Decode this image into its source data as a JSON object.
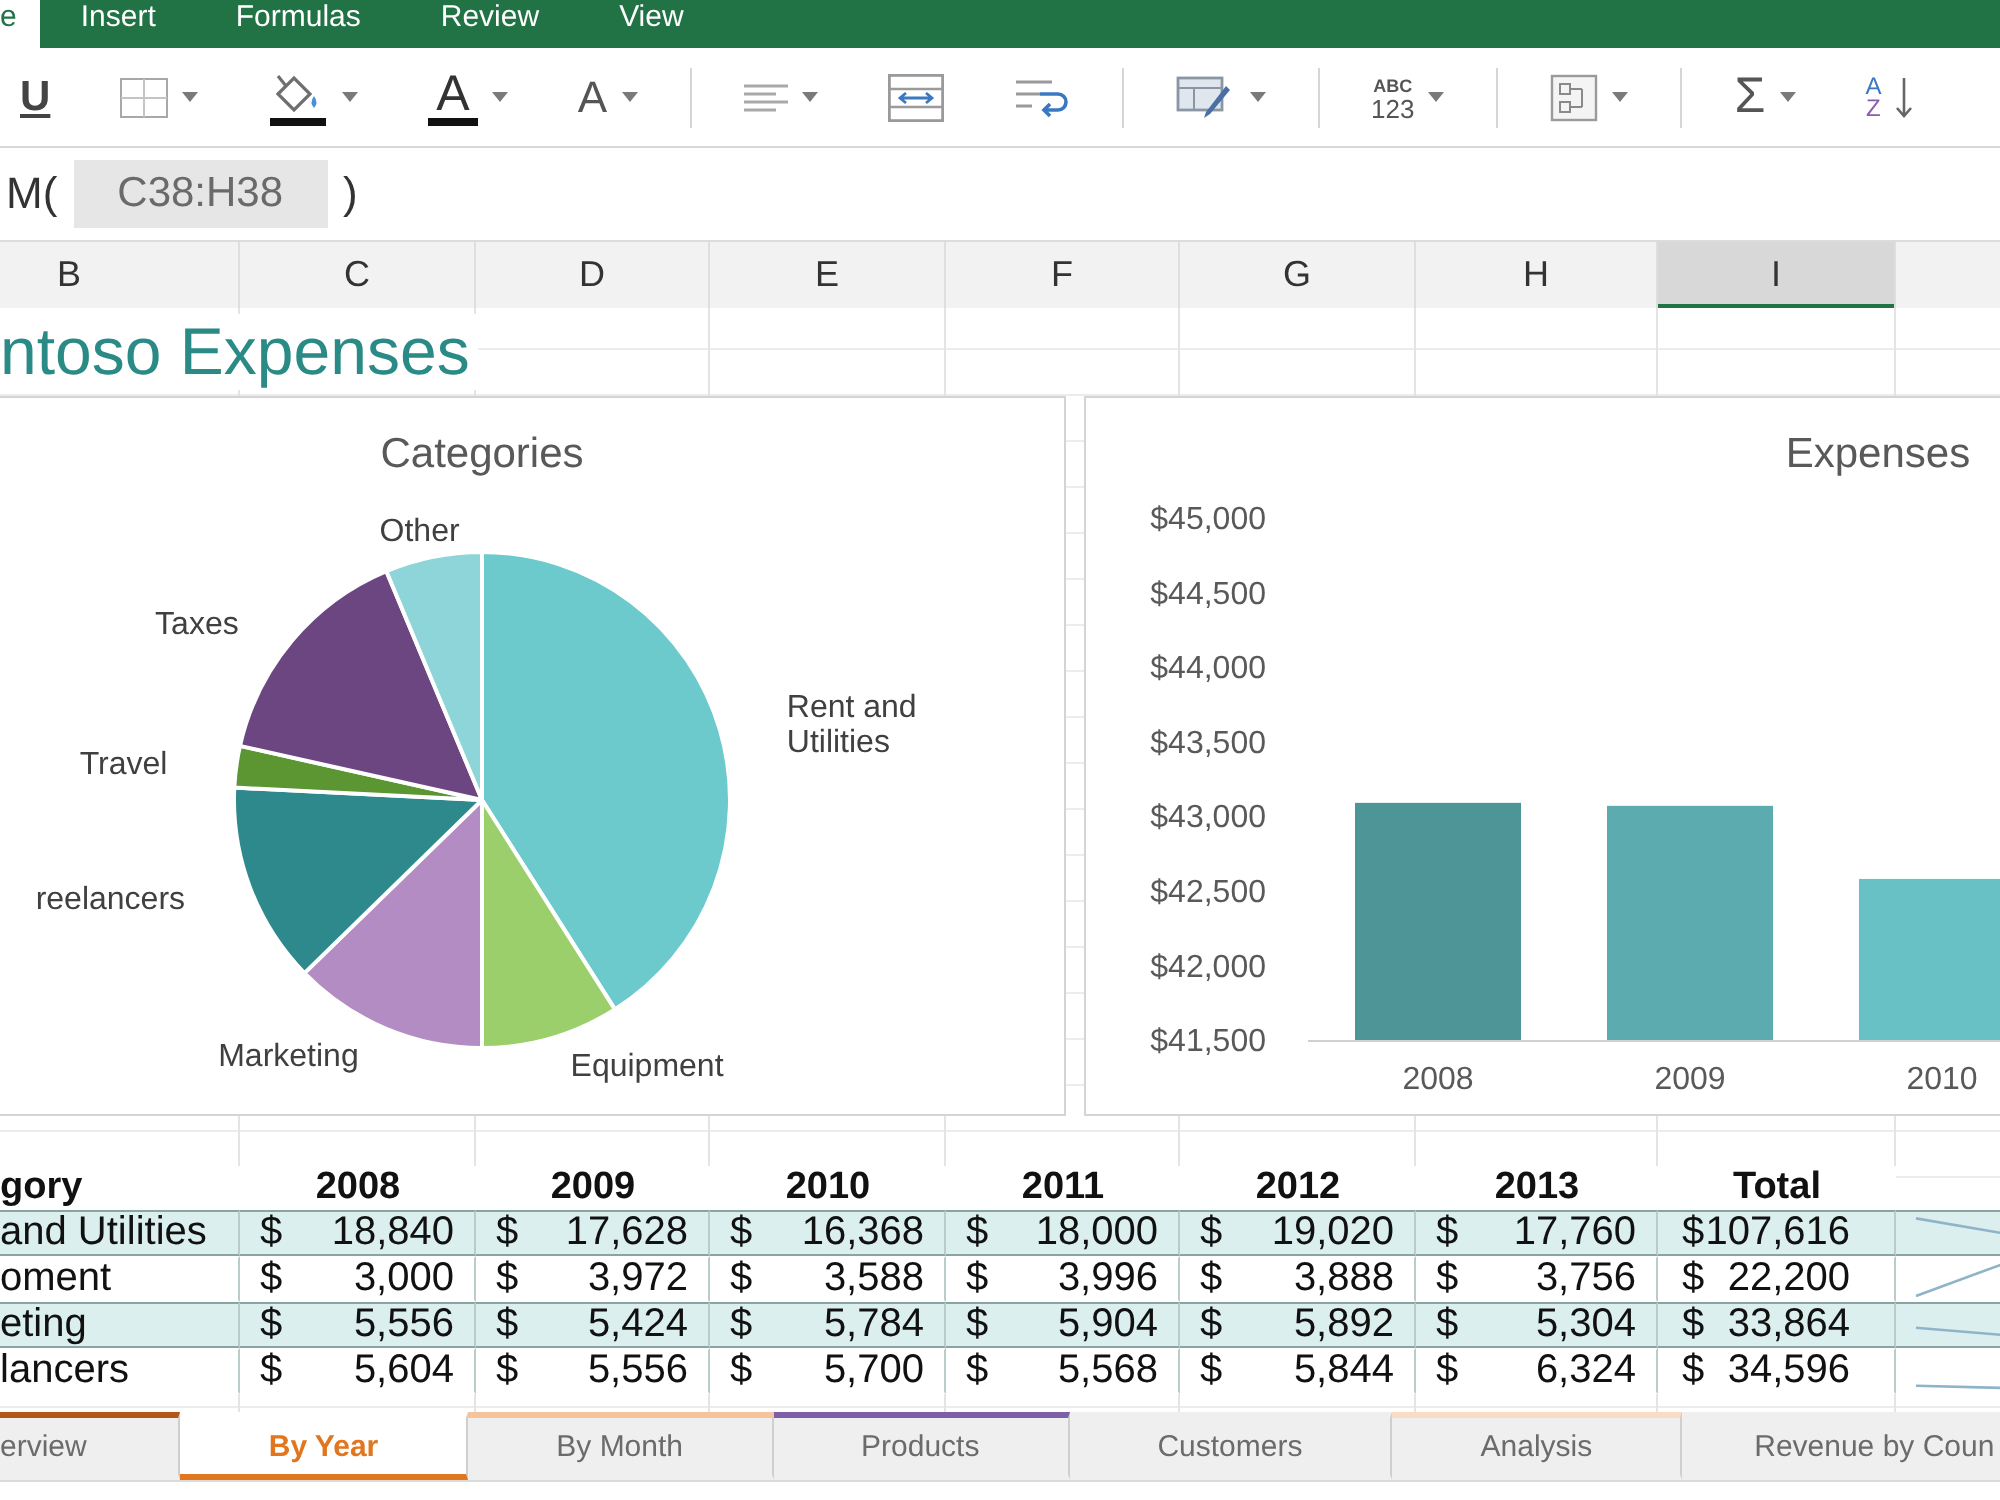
{
  "ribbon_tabs": [
    {
      "label": "e",
      "selected": true
    },
    {
      "label": "Insert",
      "selected": false
    },
    {
      "label": "Formulas",
      "selected": false
    },
    {
      "label": "Review",
      "selected": false
    },
    {
      "label": "View",
      "selected": false
    }
  ],
  "toolbar": {
    "groups": [
      [
        {
          "kind": "underline",
          "label": "U",
          "dropdown": false
        },
        {
          "kind": "borders",
          "dropdown": true
        },
        {
          "kind": "fill_color",
          "dropdown": true
        },
        {
          "kind": "font_color",
          "label": "A",
          "dropdown": true
        },
        {
          "kind": "font_size",
          "label": "A",
          "dropdown": true
        }
      ],
      [
        {
          "kind": "align",
          "dropdown": true
        },
        {
          "kind": "merge",
          "dropdown": false
        },
        {
          "kind": "wrap",
          "dropdown": false
        }
      ],
      [
        {
          "kind": "format",
          "dropdown": true
        }
      ],
      [
        {
          "kind": "number_format",
          "label": "ABC",
          "sublabel": "123",
          "dropdown": true
        }
      ],
      [
        {
          "kind": "layout",
          "dropdown": true
        }
      ],
      [
        {
          "kind": "sum",
          "label": "Σ",
          "dropdown": true
        },
        {
          "kind": "sort",
          "label": "A",
          "sublabel": "Z",
          "dropdown": false
        }
      ]
    ]
  },
  "formula_bar": {
    "prefix": "M(",
    "reference": "C38:H38",
    "suffix": ")"
  },
  "column_headers": [
    {
      "label": "B",
      "selected": false
    },
    {
      "label": "C",
      "selected": false
    },
    {
      "label": "D",
      "selected": false
    },
    {
      "label": "E",
      "selected": false
    },
    {
      "label": "F",
      "selected": false
    },
    {
      "label": "G",
      "selected": false
    },
    {
      "label": "H",
      "selected": false
    },
    {
      "label": "I",
      "selected": true
    }
  ],
  "sheet": {
    "title": "ntoso Expenses",
    "pie_chart": {
      "chart_data": [
        {
          "type": "pie",
          "title": "Categories",
          "categories": [
            "Rent and Utilities",
            "Equipment",
            "Marketing",
            "reelancers",
            "Travel",
            "Taxes",
            "Other"
          ],
          "values": [
            41,
            9,
            12.7,
            13.1,
            2.7,
            15.2,
            6.3
          ],
          "colors": [
            "#6ccacd",
            "#9bcf6b",
            "#b28cc2",
            "#2e898c",
            "#5b9632",
            "#6c4681",
            "#8ed5d9"
          ]
        }
      ]
    },
    "bar_chart": {
      "chart_data": [
        {
          "type": "bar",
          "title": "Expenses",
          "categories": [
            "2008",
            "2009",
            "2010"
          ],
          "values": [
            43090,
            43070,
            42580
          ],
          "colors": [
            "#4e9597",
            "#5cacaf",
            "#67c1c5"
          ],
          "ylim": [
            41500,
            45000
          ],
          "yticks": [
            {
              "value": 45000,
              "label": "$45,000"
            },
            {
              "value": 44500,
              "label": "$44,500"
            },
            {
              "value": 44000,
              "label": "$44,000"
            },
            {
              "value": 43500,
              "label": "$43,500"
            },
            {
              "value": 43000,
              "label": "$43,000"
            },
            {
              "value": 42500,
              "label": "$42,500"
            },
            {
              "value": 42000,
              "label": "$42,000"
            },
            {
              "value": 41500,
              "label": "$41,500"
            }
          ]
        }
      ]
    },
    "table": {
      "columns": [
        "gory",
        "2008",
        "2009",
        "2010",
        "2011",
        "2012",
        "2013",
        "Total"
      ],
      "rows": [
        {
          "cells": [
            {
              "kind": "label",
              "text": "and Utilities"
            },
            {
              "kind": "money",
              "currency": "$",
              "amount": "18,840"
            },
            {
              "kind": "money",
              "currency": "$",
              "amount": "17,628"
            },
            {
              "kind": "money",
              "currency": "$",
              "amount": "16,368"
            },
            {
              "kind": "money",
              "currency": "$",
              "amount": "18,000"
            },
            {
              "kind": "money",
              "currency": "$",
              "amount": "19,020"
            },
            {
              "kind": "money",
              "currency": "$",
              "amount": "17,760"
            },
            {
              "kind": "money",
              "currency": "$",
              "amount": "107,616"
            }
          ]
        },
        {
          "cells": [
            {
              "kind": "label",
              "text": "oment"
            },
            {
              "kind": "money",
              "currency": "$",
              "amount": "3,000"
            },
            {
              "kind": "money",
              "currency": "$",
              "amount": "3,972"
            },
            {
              "kind": "money",
              "currency": "$",
              "amount": "3,588"
            },
            {
              "kind": "money",
              "currency": "$",
              "amount": "3,996"
            },
            {
              "kind": "money",
              "currency": "$",
              "amount": "3,888"
            },
            {
              "kind": "money",
              "currency": "$",
              "amount": "3,756"
            },
            {
              "kind": "money",
              "currency": "$",
              "amount": "22,200"
            }
          ]
        },
        {
          "cells": [
            {
              "kind": "label",
              "text": "eting"
            },
            {
              "kind": "money",
              "currency": "$",
              "amount": "5,556"
            },
            {
              "kind": "money",
              "currency": "$",
              "amount": "5,424"
            },
            {
              "kind": "money",
              "currency": "$",
              "amount": "5,784"
            },
            {
              "kind": "money",
              "currency": "$",
              "amount": "5,904"
            },
            {
              "kind": "money",
              "currency": "$",
              "amount": "5,892"
            },
            {
              "kind": "money",
              "currency": "$",
              "amount": "5,304"
            },
            {
              "kind": "money",
              "currency": "$",
              "amount": "33,864"
            }
          ]
        },
        {
          "cells": [
            {
              "kind": "label",
              "text": "lancers"
            },
            {
              "kind": "money",
              "currency": "$",
              "amount": "5,604"
            },
            {
              "kind": "money",
              "currency": "$",
              "amount": "5,556"
            },
            {
              "kind": "money",
              "currency": "$",
              "amount": "5,700"
            },
            {
              "kind": "money",
              "currency": "$",
              "amount": "5,568"
            },
            {
              "kind": "money",
              "currency": "$",
              "amount": "5,844"
            },
            {
              "kind": "money",
              "currency": "$",
              "amount": "6,324"
            },
            {
              "kind": "money",
              "currency": "$",
              "amount": "34,596"
            }
          ]
        }
      ]
    }
  },
  "sheet_tabs": [
    {
      "label": "erview",
      "selected": false,
      "color": "#b4561a"
    },
    {
      "label": "By Year",
      "selected": true,
      "color": "#e2761f"
    },
    {
      "label": "By Month",
      "selected": false,
      "color": "#f6c49c"
    },
    {
      "label": "Products",
      "selected": false,
      "color": "#7e60a8"
    },
    {
      "label": "Customers",
      "selected": false
    },
    {
      "label": "Analysis",
      "selected": false,
      "color": "#fadcc4"
    },
    {
      "label": "Revenue by Coun",
      "selected": false
    }
  ]
}
